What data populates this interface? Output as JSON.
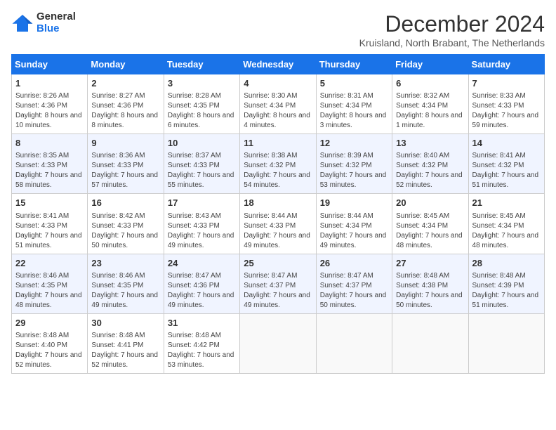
{
  "header": {
    "logo_line1": "General",
    "logo_line2": "Blue",
    "month_title": "December 2024",
    "subtitle": "Kruisland, North Brabant, The Netherlands"
  },
  "days_of_week": [
    "Sunday",
    "Monday",
    "Tuesday",
    "Wednesday",
    "Thursday",
    "Friday",
    "Saturday"
  ],
  "weeks": [
    [
      {
        "day": "1",
        "info": "Sunrise: 8:26 AM\nSunset: 4:36 PM\nDaylight: 8 hours and 10 minutes."
      },
      {
        "day": "2",
        "info": "Sunrise: 8:27 AM\nSunset: 4:36 PM\nDaylight: 8 hours and 8 minutes."
      },
      {
        "day": "3",
        "info": "Sunrise: 8:28 AM\nSunset: 4:35 PM\nDaylight: 8 hours and 6 minutes."
      },
      {
        "day": "4",
        "info": "Sunrise: 8:30 AM\nSunset: 4:34 PM\nDaylight: 8 hours and 4 minutes."
      },
      {
        "day": "5",
        "info": "Sunrise: 8:31 AM\nSunset: 4:34 PM\nDaylight: 8 hours and 3 minutes."
      },
      {
        "day": "6",
        "info": "Sunrise: 8:32 AM\nSunset: 4:34 PM\nDaylight: 8 hours and 1 minute."
      },
      {
        "day": "7",
        "info": "Sunrise: 8:33 AM\nSunset: 4:33 PM\nDaylight: 7 hours and 59 minutes."
      }
    ],
    [
      {
        "day": "8",
        "info": "Sunrise: 8:35 AM\nSunset: 4:33 PM\nDaylight: 7 hours and 58 minutes."
      },
      {
        "day": "9",
        "info": "Sunrise: 8:36 AM\nSunset: 4:33 PM\nDaylight: 7 hours and 57 minutes."
      },
      {
        "day": "10",
        "info": "Sunrise: 8:37 AM\nSunset: 4:33 PM\nDaylight: 7 hours and 55 minutes."
      },
      {
        "day": "11",
        "info": "Sunrise: 8:38 AM\nSunset: 4:32 PM\nDaylight: 7 hours and 54 minutes."
      },
      {
        "day": "12",
        "info": "Sunrise: 8:39 AM\nSunset: 4:32 PM\nDaylight: 7 hours and 53 minutes."
      },
      {
        "day": "13",
        "info": "Sunrise: 8:40 AM\nSunset: 4:32 PM\nDaylight: 7 hours and 52 minutes."
      },
      {
        "day": "14",
        "info": "Sunrise: 8:41 AM\nSunset: 4:32 PM\nDaylight: 7 hours and 51 minutes."
      }
    ],
    [
      {
        "day": "15",
        "info": "Sunrise: 8:41 AM\nSunset: 4:33 PM\nDaylight: 7 hours and 51 minutes."
      },
      {
        "day": "16",
        "info": "Sunrise: 8:42 AM\nSunset: 4:33 PM\nDaylight: 7 hours and 50 minutes."
      },
      {
        "day": "17",
        "info": "Sunrise: 8:43 AM\nSunset: 4:33 PM\nDaylight: 7 hours and 49 minutes."
      },
      {
        "day": "18",
        "info": "Sunrise: 8:44 AM\nSunset: 4:33 PM\nDaylight: 7 hours and 49 minutes."
      },
      {
        "day": "19",
        "info": "Sunrise: 8:44 AM\nSunset: 4:34 PM\nDaylight: 7 hours and 49 minutes."
      },
      {
        "day": "20",
        "info": "Sunrise: 8:45 AM\nSunset: 4:34 PM\nDaylight: 7 hours and 48 minutes."
      },
      {
        "day": "21",
        "info": "Sunrise: 8:45 AM\nSunset: 4:34 PM\nDaylight: 7 hours and 48 minutes."
      }
    ],
    [
      {
        "day": "22",
        "info": "Sunrise: 8:46 AM\nSunset: 4:35 PM\nDaylight: 7 hours and 48 minutes."
      },
      {
        "day": "23",
        "info": "Sunrise: 8:46 AM\nSunset: 4:35 PM\nDaylight: 7 hours and 49 minutes."
      },
      {
        "day": "24",
        "info": "Sunrise: 8:47 AM\nSunset: 4:36 PM\nDaylight: 7 hours and 49 minutes."
      },
      {
        "day": "25",
        "info": "Sunrise: 8:47 AM\nSunset: 4:37 PM\nDaylight: 7 hours and 49 minutes."
      },
      {
        "day": "26",
        "info": "Sunrise: 8:47 AM\nSunset: 4:37 PM\nDaylight: 7 hours and 50 minutes."
      },
      {
        "day": "27",
        "info": "Sunrise: 8:48 AM\nSunset: 4:38 PM\nDaylight: 7 hours and 50 minutes."
      },
      {
        "day": "28",
        "info": "Sunrise: 8:48 AM\nSunset: 4:39 PM\nDaylight: 7 hours and 51 minutes."
      }
    ],
    [
      {
        "day": "29",
        "info": "Sunrise: 8:48 AM\nSunset: 4:40 PM\nDaylight: 7 hours and 52 minutes."
      },
      {
        "day": "30",
        "info": "Sunrise: 8:48 AM\nSunset: 4:41 PM\nDaylight: 7 hours and 52 minutes."
      },
      {
        "day": "31",
        "info": "Sunrise: 8:48 AM\nSunset: 4:42 PM\nDaylight: 7 hours and 53 minutes."
      },
      null,
      null,
      null,
      null
    ]
  ],
  "row_styles": [
    "row-white",
    "row-shaded",
    "row-white",
    "row-shaded",
    "row-white"
  ]
}
